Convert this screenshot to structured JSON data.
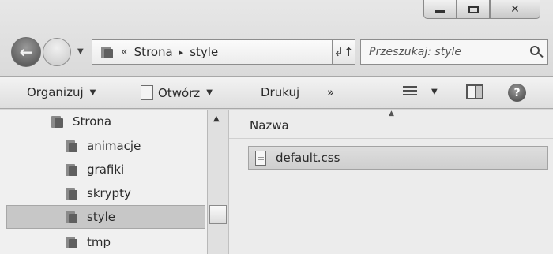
{
  "window": {
    "controls": {
      "minimize": "–",
      "maximize": "□",
      "close": "✕"
    }
  },
  "navigation": {
    "back_icon": "back-arrow-icon",
    "forward_icon": "forward-arrow-icon",
    "address": {
      "prefix": "«",
      "crumbs": [
        "Strona",
        "style"
      ],
      "separator": "▸"
    },
    "refresh_glyph": "↲↑",
    "search": {
      "placeholder": "Przeszukaj: style"
    }
  },
  "toolbar": {
    "organize_label": "Organizuj",
    "open_label": "Otwórz",
    "print_label": "Drukuj",
    "more_label": "»",
    "help_label": "?"
  },
  "nav_pane": {
    "items": [
      {
        "label": "Strona",
        "level": 0,
        "selected": false
      },
      {
        "label": "animacje",
        "level": 1,
        "selected": false
      },
      {
        "label": "grafiki",
        "level": 1,
        "selected": false
      },
      {
        "label": "skrypty",
        "level": 1,
        "selected": false
      },
      {
        "label": "style",
        "level": 1,
        "selected": true
      },
      {
        "label": "tmp",
        "level": 1,
        "selected": false
      }
    ]
  },
  "content": {
    "column_header": "Nazwa",
    "files": [
      {
        "name": "default.css",
        "icon": "css-file-icon"
      }
    ]
  }
}
